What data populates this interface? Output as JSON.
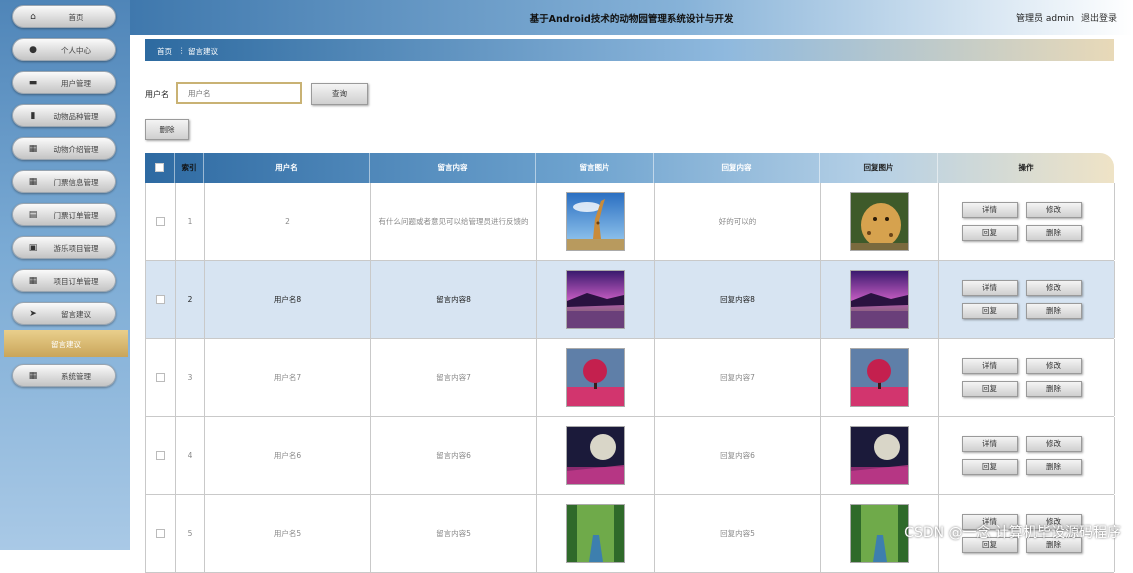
{
  "header": {
    "title": "基于Android技术的动物园管理系统设计与开发",
    "user_label": "管理员 admin",
    "logout_label": "退出登录"
  },
  "sidebar": {
    "items": [
      {
        "label": "首页",
        "icon": "home-icon"
      },
      {
        "label": "个人中心",
        "icon": "person-icon"
      },
      {
        "label": "用户管理",
        "icon": "briefcase-icon"
      },
      {
        "label": "动物品种管理",
        "icon": "bar-chart-icon"
      },
      {
        "label": "动物介绍管理",
        "icon": "grid-icon"
      },
      {
        "label": "门票信息管理",
        "icon": "grid-icon"
      },
      {
        "label": "门票订单管理",
        "icon": "document-icon"
      },
      {
        "label": "游乐项目管理",
        "icon": "clipboard-icon"
      },
      {
        "label": "项目订单管理",
        "icon": "grid-icon"
      },
      {
        "label": "留言建议",
        "icon": "send-icon"
      },
      {
        "label": "系统管理",
        "icon": "grid-icon"
      }
    ],
    "active_sub_item": "留言建议"
  },
  "breadcrumb": {
    "home": "首页",
    "separator": "⋮",
    "current": "留言建议"
  },
  "search": {
    "label": "用户名",
    "placeholder": "用户名",
    "value": "",
    "button_label": "查询",
    "delete_label": "删除"
  },
  "table": {
    "columns": [
      "索引",
      "用户名",
      "留言内容",
      "留言图片",
      "回复内容",
      "回复图片",
      "操作"
    ],
    "rows": [
      {
        "index": "1",
        "username": "2",
        "message": "有什么问题或者意见可以给管理员进行反馈的",
        "message_image": "giraffe",
        "reply": "好的可以的",
        "reply_image": "leopard",
        "highlighted": false
      },
      {
        "index": "2",
        "username": "用户名8",
        "message": "留言内容8",
        "message_image": "purple-field",
        "reply": "回复内容8",
        "reply_image": "purple-field",
        "highlighted": true
      },
      {
        "index": "3",
        "username": "用户名7",
        "message": "留言内容7",
        "message_image": "pink-tree",
        "reply": "回复内容7",
        "reply_image": "pink-tree",
        "highlighted": false
      },
      {
        "index": "4",
        "username": "用户名6",
        "message": "留言内容6",
        "message_image": "moon-night",
        "reply": "回复内容6",
        "reply_image": "moon-night",
        "highlighted": false
      },
      {
        "index": "5",
        "username": "用户名5",
        "message": "留言内容5",
        "message_image": "green-river",
        "reply": "回复内容5",
        "reply_image": "green-river",
        "highlighted": false
      }
    ],
    "actions": [
      "详情",
      "修改",
      "回复",
      "删除"
    ]
  },
  "watermark": "CSDN @一念 计算机毕设源码程序"
}
